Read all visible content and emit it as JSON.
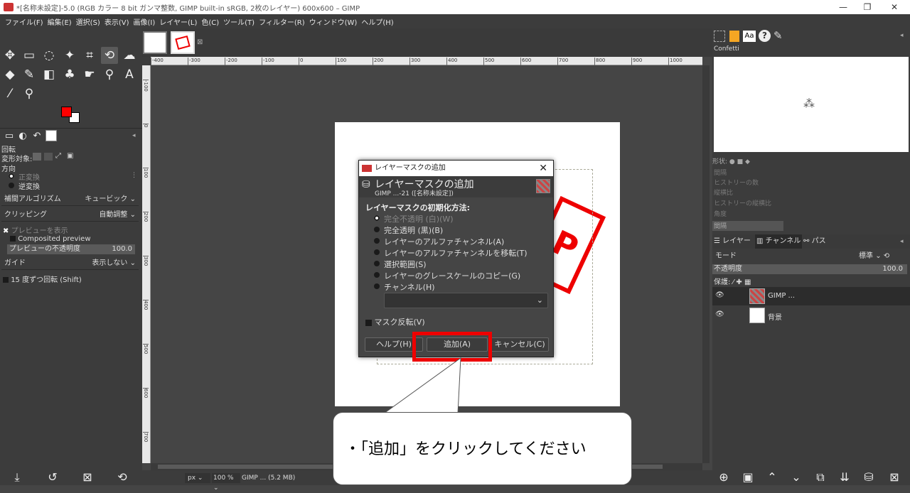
{
  "window": {
    "title": "*[名称未設定]-5.0 (RGB カラー 8 bit ガンマ整数, GIMP built-in sRGB, 2枚のレイヤー) 600x600 – GIMP",
    "minimize": "—",
    "restore": "❐",
    "close": "✕"
  },
  "menu": [
    "ファイル(F)",
    "編集(E)",
    "選択(S)",
    "表示(V)",
    "画像(I)",
    "レイヤー(L)",
    "色(C)",
    "ツール(T)",
    "フィルター(R)",
    "ウィンドウ(W)",
    "ヘルプ(H)"
  ],
  "tool_options": {
    "section": "回転",
    "transform_target": "変形対象:",
    "direction": "方向",
    "forward": "正変換",
    "reverse": "逆変換",
    "interpolation_label": "補間アルゴリズム",
    "interpolation_value": "キュービック",
    "clipping_label": "クリッピング",
    "clipping_value": "自動調整",
    "show_preview": "プレビューを表示",
    "composited_preview": "Composited preview",
    "preview_opacity_label": "プレビューの不透明度",
    "preview_opacity_value": "100.0",
    "guide_label": "ガイド",
    "guide_value": "表示しない",
    "rotate_15": "15 度ずつ回転 (Shift)"
  },
  "ruler": {
    "h_ticks": [
      "-400",
      "-300",
      "-200",
      "-100",
      "0",
      "100",
      "200",
      "300",
      "400",
      "500",
      "600",
      "700",
      "800",
      "900",
      "1000"
    ],
    "v_ticks": [
      "-100",
      "0",
      "100",
      "200",
      "300",
      "400",
      "500",
      "600",
      "700"
    ]
  },
  "statusbar": {
    "unit": "px",
    "zoom": "100 %",
    "info": "GIMP ... (5.2 MB)"
  },
  "dialog": {
    "window_title": "レイヤーマスクの追加",
    "heading": "レイヤーマスクの追加",
    "subheading": "GIMP ...-21 ([名称未設定])",
    "init_label": "レイヤーマスクの初期化方法:",
    "options": [
      "完全不透明 (白)(W)",
      "完全透明 (黒)(B)",
      "レイヤーのアルファチャンネル(A)",
      "レイヤーのアルファチャンネルを移転(T)",
      "選択範囲(S)",
      "レイヤーのグレースケールのコピー(G)",
      "チャンネル(H)"
    ],
    "invert_mask": "マスク反転(V)",
    "help_button": "ヘルプ(H)",
    "add_button": "追加(A)",
    "cancel_button": "キャンセル(C)",
    "close": "✕"
  },
  "right_panel": {
    "brush_name": "Confetti",
    "shape_label": "形状:",
    "layers_tab": "レイヤー",
    "channels_tab": "チャンネル",
    "paths_tab": "パス",
    "mode_label": "モード",
    "mode_value": "標準",
    "opacity_label": "不透明度",
    "opacity_value": "100.0",
    "lock_label": "保護:",
    "layers": [
      {
        "name": "GIMP ..."
      },
      {
        "name": "背景"
      }
    ],
    "dim_rows": [
      "間隔",
      "ヒストリーの数",
      "縦横比",
      "ヒストリーの縦横比",
      "角度",
      "間隔"
    ]
  },
  "stamp_text": "P",
  "callout": {
    "text": "・「追加」をクリックしてください"
  },
  "colors": {
    "foreground": "#ff0000",
    "background": "#ffffff",
    "highlight": "#e00000"
  }
}
